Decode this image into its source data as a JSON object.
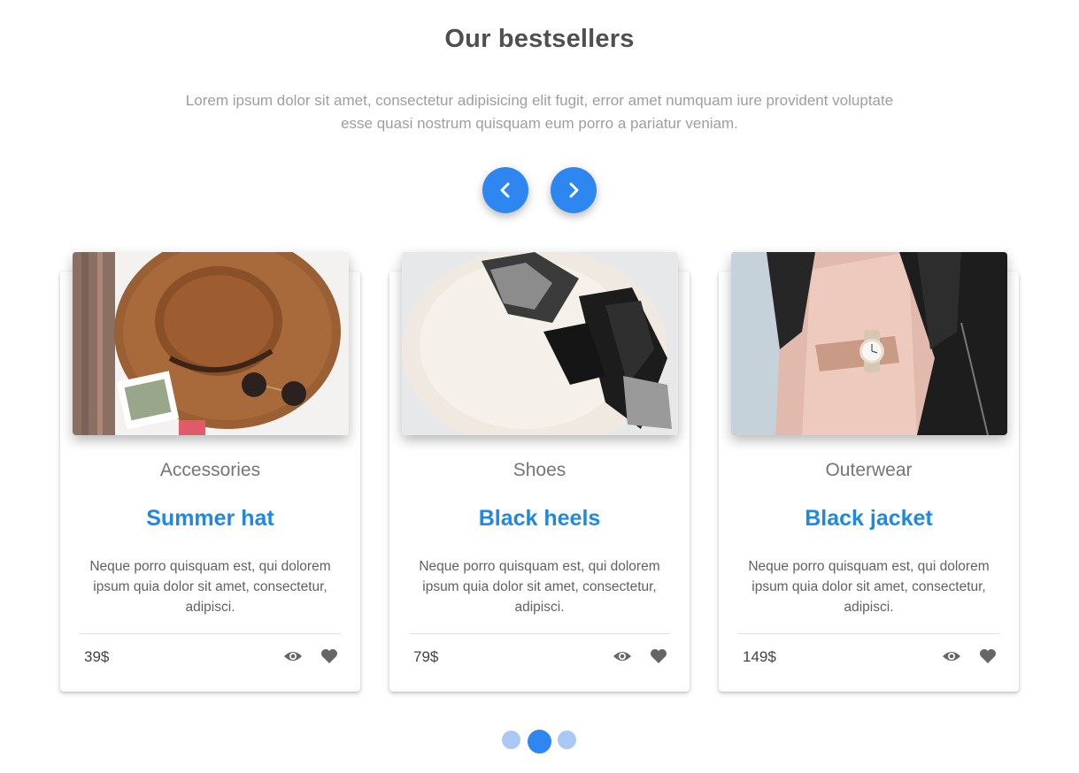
{
  "section": {
    "title": "Our bestsellers",
    "description": "Lorem ipsum dolor sit amet, consectetur adipisicing elit fugit, error amet numquam iure provident voluptate esse quasi nostrum quisquam eum porro a pariatur veniam."
  },
  "carousel": {
    "prev_icon": "chevron-left-icon",
    "next_icon": "chevron-right-icon",
    "accent_color": "#2e86f0",
    "indicators": [
      {
        "active": false
      },
      {
        "active": true
      },
      {
        "active": false
      }
    ]
  },
  "products": [
    {
      "category": "Accessories",
      "title": "Summer hat",
      "description": "Neque porro quisquam est, qui dolorem ipsum quia dolor sit amet, consectetur, adipisci.",
      "price": "39$",
      "image": "brown-hat-with-sunglasses-photo"
    },
    {
      "category": "Shoes",
      "title": "Black heels",
      "description": "Neque porro quisquam est, qui dolorem ipsum quia dolor sit amet, consectetur, adipisci.",
      "price": "79$",
      "image": "black-heels-on-fur-photo"
    },
    {
      "category": "Outerwear",
      "title": "Black jacket",
      "description": "Neque porro quisquam est, qui dolorem ipsum quia dolor sit amet, consectetur, adipisci.",
      "price": "149$",
      "image": "black-leather-jacket-with-watch-photo"
    }
  ],
  "card_actions": {
    "view_icon": "eye-icon",
    "favorite_icon": "heart-icon"
  },
  "colors": {
    "title_blue": "#1e88e5",
    "text_gray": "#616161"
  }
}
